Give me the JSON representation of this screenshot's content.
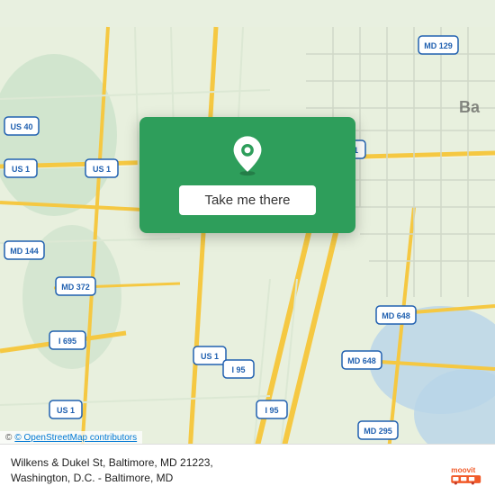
{
  "map": {
    "background_color": "#e8f0de",
    "center_lat": 39.27,
    "center_lng": -76.65
  },
  "overlay": {
    "background_color": "#2e9e5b",
    "button_label": "Take me there"
  },
  "bottom_bar": {
    "address_line1": "Wilkens & Dukel St, Baltimore, MD 21223,",
    "address_line2": "Washington, D.C. - Baltimore, MD",
    "copyright": "© OpenStreetMap contributors"
  },
  "moovit": {
    "brand": "moovit"
  }
}
